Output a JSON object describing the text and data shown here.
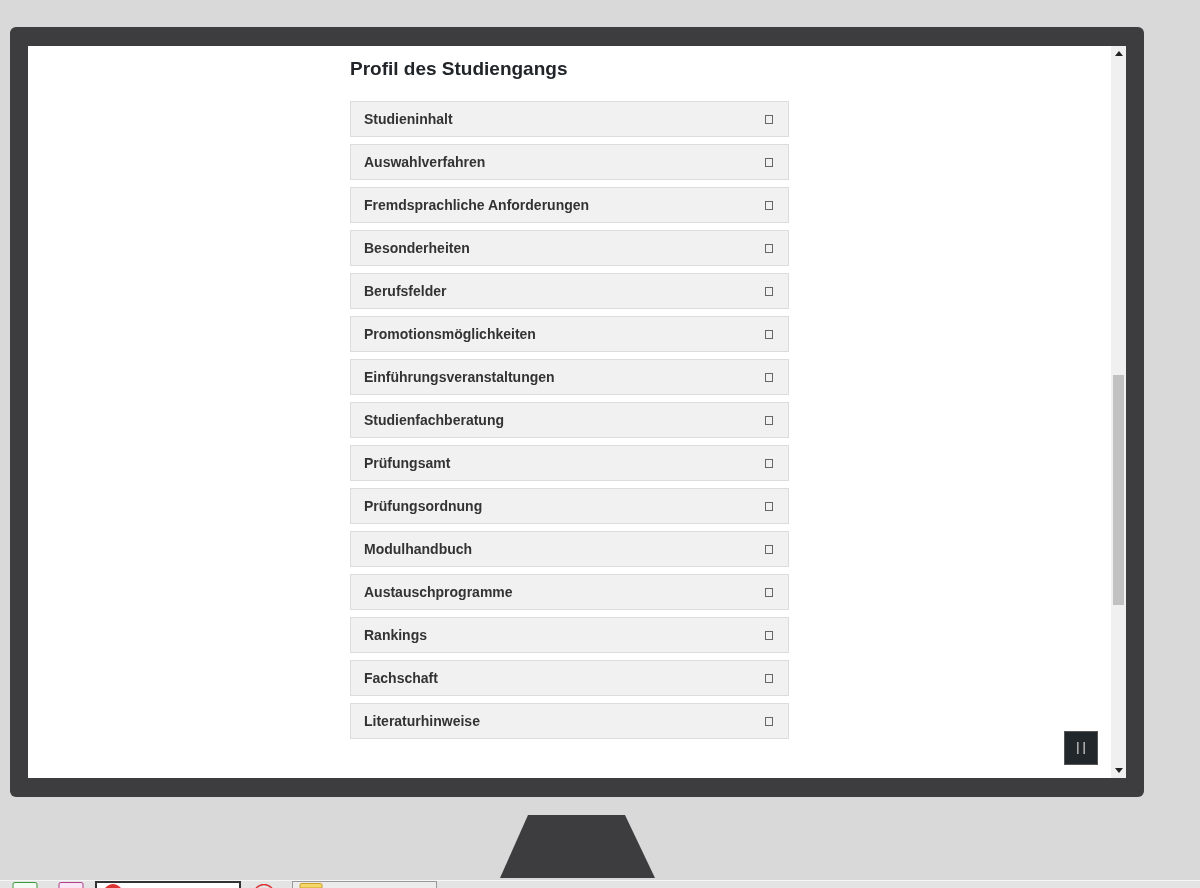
{
  "section": {
    "title": "Profil des Studiengangs"
  },
  "accordion": {
    "items": [
      {
        "label": "Studieninhalt"
      },
      {
        "label": "Auswahlverfahren"
      },
      {
        "label": "Fremdsprachliche Anforderungen"
      },
      {
        "label": "Besonderheiten"
      },
      {
        "label": "Berufsfelder"
      },
      {
        "label": "Promotionsmöglichkeiten"
      },
      {
        "label": "Einführungsveranstaltungen"
      },
      {
        "label": "Studienfachberatung"
      },
      {
        "label": "Prüfungsamt"
      },
      {
        "label": "Prüfungsordnung"
      },
      {
        "label": "Modulhandbuch"
      },
      {
        "label": "Austauschprogramme"
      },
      {
        "label": "Rankings"
      },
      {
        "label": "Fachschaft"
      },
      {
        "label": "Literaturhinweise"
      }
    ]
  }
}
